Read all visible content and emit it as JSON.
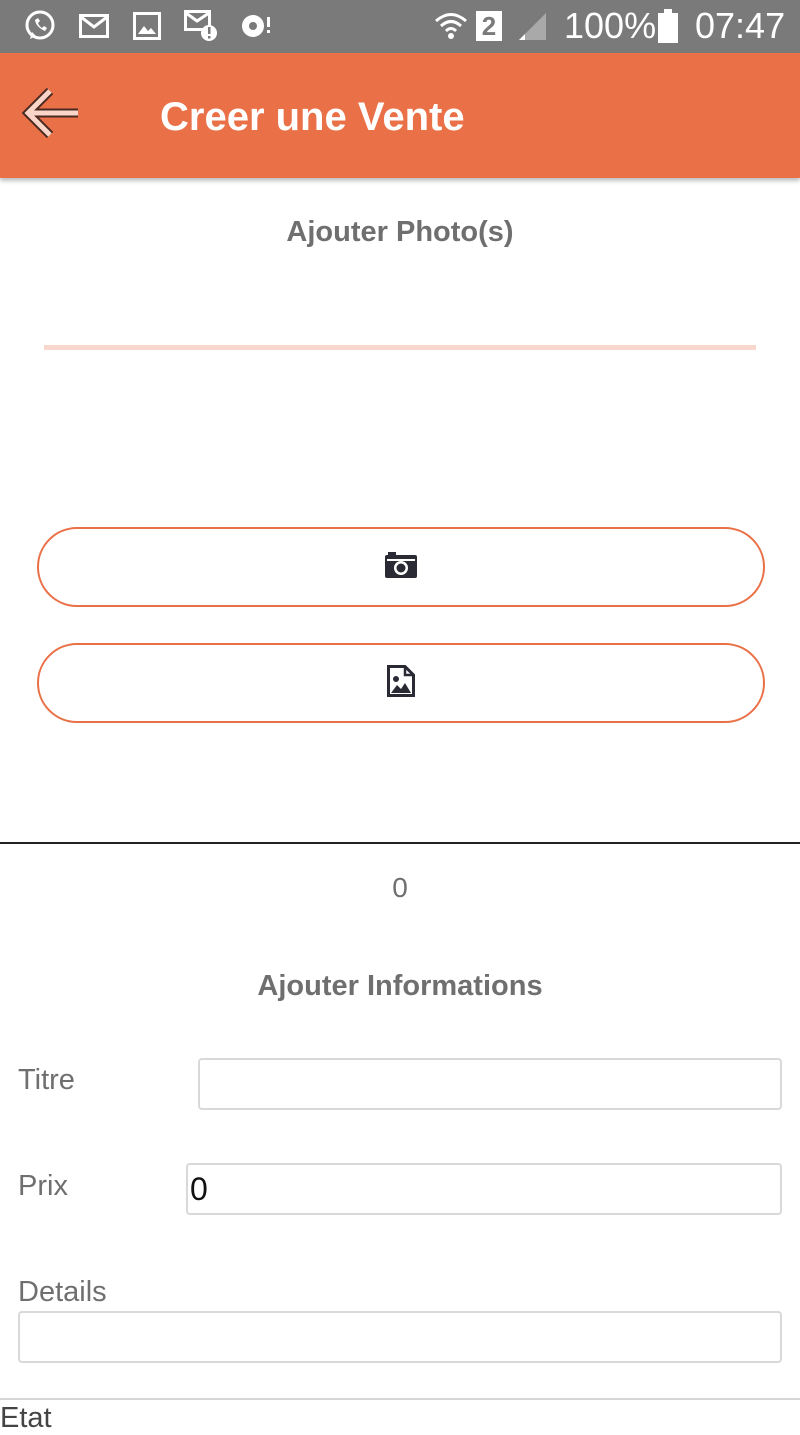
{
  "status_bar": {
    "icons": [
      "whatsapp-icon",
      "mail-icon",
      "gallery-icon",
      "mail-alert-icon",
      "sync-icon",
      "wifi-icon",
      "sim-2-icon",
      "signal-icon",
      "battery-icon"
    ],
    "sim_badge": "2",
    "battery": "100%",
    "time": "07:47"
  },
  "app_bar": {
    "title": "Creer une Vente",
    "back_icon": "arrow-left-icon",
    "background": "#e97047"
  },
  "photos": {
    "title": "Ajouter Photo(s)",
    "camera_button_icon": "camera-icon",
    "gallery_button_icon": "image-file-icon",
    "count": "0"
  },
  "info": {
    "title": "Ajouter Informations",
    "titre_label": "Titre",
    "titre_value": "",
    "prix_label": "Prix",
    "prix_value": "0",
    "details_label": "Details",
    "details_value": "",
    "etat_label": "Etat"
  },
  "colors": {
    "accent": "#e97047",
    "accent_light": "#f9d7cd",
    "status_bar": "#7a7a7a",
    "text_gray": "#6f6f6f"
  }
}
